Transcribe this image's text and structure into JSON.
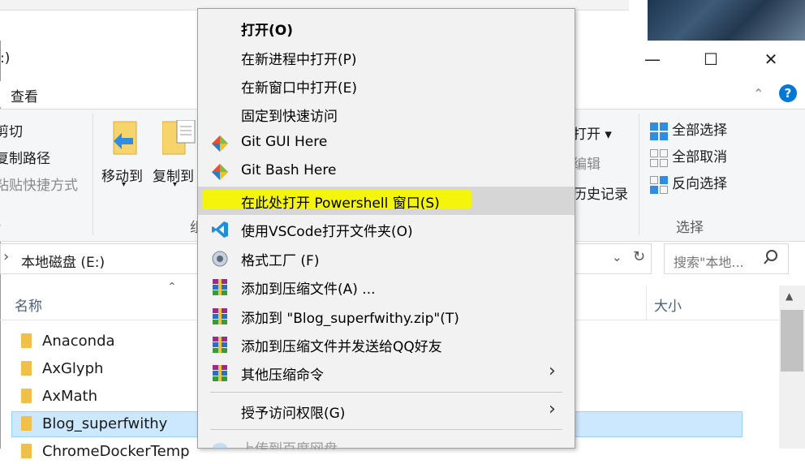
{
  "window": {
    "title_fragment": ":)",
    "controls": {
      "minimize": "—",
      "maximize": "☐",
      "close": "✕"
    }
  },
  "ribbon": {
    "tab_view": "查看",
    "clipboard": {
      "cut": "剪切",
      "copy_path": "复制路径",
      "paste_shortcut": "粘贴快捷方式"
    },
    "organize": {
      "move_to": "移动到",
      "copy_to": "复制到",
      "group_label_fragment": "组"
    },
    "open": {
      "open_fragment": "打开 ▾",
      "edit_fragment": "编辑",
      "history_fragment": "历史记录"
    },
    "select": {
      "select_all": "全部选择",
      "select_none": "全部取消",
      "invert": "反向选择",
      "group_label": "选择"
    }
  },
  "address": {
    "path": "本地磁盘 (E:)",
    "search_placeholder": "搜索\"本地...",
    "chevron": "›"
  },
  "list": {
    "headers": {
      "name": "名称",
      "size": "大小"
    },
    "rows": [
      "Anaconda",
      "AxGlyph",
      "AxMath",
      "Blog_superfwithy",
      "ChromeDockerTemp"
    ]
  },
  "context_menu": {
    "items": [
      {
        "label": "打开(O)",
        "bold": true
      },
      {
        "label": "在新进程中打开(P)"
      },
      {
        "label": "在新窗口中打开(E)"
      },
      {
        "label": "固定到快速访问"
      },
      {
        "label": "Git GUI Here",
        "icon": "git-gui-icon"
      },
      {
        "label": "Git Bash Here",
        "icon": "git-bash-icon"
      },
      {
        "label": "在此处打开 Powershell 窗口(S)",
        "highlighted": true
      },
      {
        "label": "使用VSCode打开文件夹(O)",
        "icon": "vscode-icon"
      },
      {
        "label": "格式工厂 (F)",
        "icon": "format-factory-icon"
      },
      {
        "label": "添加到压缩文件(A) ...",
        "icon": "winrar-icon"
      },
      {
        "label": "添加到 \"Blog_superfwithy.zip\"(T)",
        "icon": "winrar-icon"
      },
      {
        "label": "添加到压缩文件并发送给QQ好友",
        "icon": "winrar-icon"
      },
      {
        "label": "其他压缩命令",
        "icon": "winrar-icon",
        "submenu": true
      },
      {
        "label": "授予访问权限(G)",
        "submenu": true
      },
      {
        "label": "上传到百度网盘",
        "icon": "baidu-icon"
      }
    ],
    "submenu_arrow": "›"
  },
  "colors": {
    "accent": "#0078d7",
    "highlight_marker": "#f4f40c",
    "selection": "#cce8ff",
    "folder": "#f0c048"
  }
}
